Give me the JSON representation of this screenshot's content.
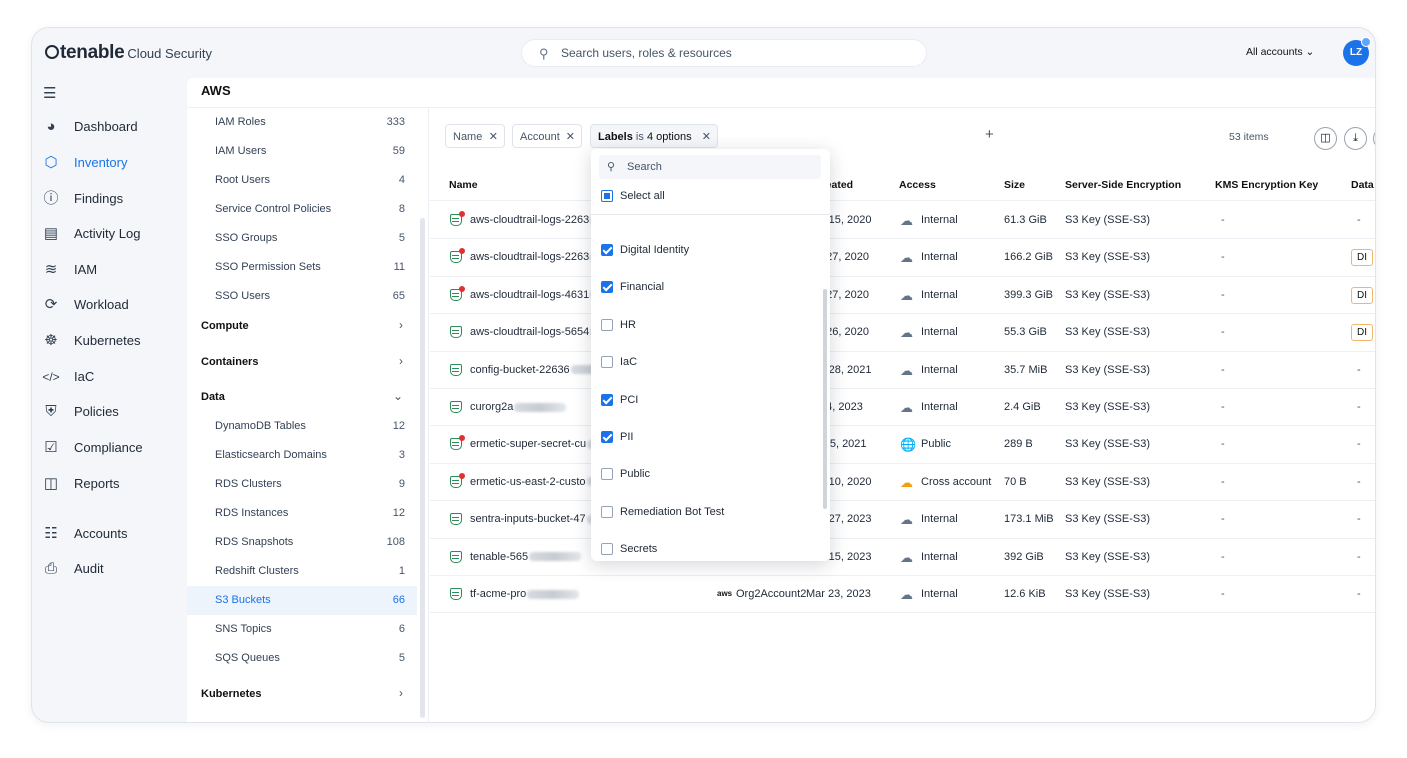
{
  "header": {
    "logo_main": "tenable",
    "logo_sub": "Cloud Security",
    "search_placeholder": "Search users, roles & resources",
    "accounts": "All accounts",
    "avatar": "LZ"
  },
  "nav": {
    "items": [
      {
        "label": "Dashboard",
        "icon": "pie-chart-icon"
      },
      {
        "label": "Inventory",
        "icon": "cube-icon",
        "active": true
      },
      {
        "label": "Findings",
        "icon": "alert-circle-icon"
      },
      {
        "label": "Activity Log",
        "icon": "document-log-icon"
      },
      {
        "label": "IAM",
        "icon": "fingerprint-icon"
      },
      {
        "label": "Workload",
        "icon": "workload-icon"
      },
      {
        "label": "Kubernetes",
        "icon": "kubernetes-helm-icon"
      },
      {
        "label": "IaC",
        "icon": "code-icon"
      },
      {
        "label": "Policies",
        "icon": "shield-check-icon"
      },
      {
        "label": "Compliance",
        "icon": "checkbox-icon"
      },
      {
        "label": "Reports",
        "icon": "report-chart-icon"
      },
      {
        "label": "Accounts",
        "icon": "org-tree-icon"
      },
      {
        "label": "Audit",
        "icon": "audit-search-icon"
      }
    ]
  },
  "panel": {
    "title": "AWS"
  },
  "tree": {
    "iam_items": [
      {
        "label": "IAM Roles",
        "count": "333"
      },
      {
        "label": "IAM Users",
        "count": "59"
      },
      {
        "label": "Root Users",
        "count": "4"
      },
      {
        "label": "Service Control Policies",
        "count": "8"
      },
      {
        "label": "SSO Groups",
        "count": "5"
      },
      {
        "label": "SSO Permission Sets",
        "count": "11"
      },
      {
        "label": "SSO Users",
        "count": "65"
      }
    ],
    "groups": {
      "compute": "Compute",
      "containers": "Containers",
      "data": "Data",
      "kubernetes": "Kubernetes"
    },
    "data_items": [
      {
        "label": "DynamoDB Tables",
        "count": "12"
      },
      {
        "label": "Elasticsearch Domains",
        "count": "3"
      },
      {
        "label": "RDS Clusters",
        "count": "9"
      },
      {
        "label": "RDS Instances",
        "count": "12"
      },
      {
        "label": "RDS Snapshots",
        "count": "108"
      },
      {
        "label": "Redshift Clusters",
        "count": "1"
      },
      {
        "label": "S3 Buckets",
        "count": "66",
        "selected": true
      },
      {
        "label": "SNS Topics",
        "count": "6"
      },
      {
        "label": "SQS Queues",
        "count": "5"
      }
    ]
  },
  "filters": {
    "name": "Name",
    "account": "Account",
    "labels_key": "Labels",
    "labels_op": "is",
    "labels_val": "4 options",
    "items_count": "53 items"
  },
  "table": {
    "headers": {
      "name": "Name",
      "created": "Created",
      "access": "Access",
      "size": "Size",
      "sse": "Server-Side Encryption",
      "kms": "KMS Encryption Key",
      "data": "Data"
    },
    "rows": [
      {
        "name": "aws-cloudtrail-logs-2263",
        "created": "Nov 15, 2020",
        "access": "Internal",
        "size": "61.3 GiB",
        "sse": "S3 Key (SSE-S3)",
        "kms": "-",
        "data": "-",
        "alert": true
      },
      {
        "name": "aws-cloudtrail-logs-2263",
        "created": "Oct 27, 2020",
        "access": "Internal",
        "size": "166.2 GiB",
        "sse": "S3 Key (SSE-S3)",
        "kms": "-",
        "data": "DI",
        "alert": true
      },
      {
        "name": "aws-cloudtrail-logs-4631",
        "created": "Oct 27, 2020",
        "access": "Internal",
        "size": "399.3 GiB",
        "sse": "S3 Key (SSE-S3)",
        "kms": "-",
        "data": "DI",
        "alert": true
      },
      {
        "name": "aws-cloudtrail-logs-5654",
        "created": "Oct 26, 2020",
        "access": "Internal",
        "size": "55.3 GiB",
        "sse": "S3 Key (SSE-S3)",
        "kms": "-",
        "data": "DI",
        "alert": false
      },
      {
        "name": "config-bucket-22636",
        "created": "Aug 28, 2021",
        "access": "Internal",
        "size": "35.7 MiB",
        "sse": "S3 Key (SSE-S3)",
        "kms": "-",
        "data": "-",
        "alert": false
      },
      {
        "name": "curorg2a",
        "created": "Apr 4, 2023",
        "access": "Internal",
        "size": "2.4 GiB",
        "sse": "S3 Key (SSE-S3)",
        "kms": "-",
        "data": "-",
        "alert": false
      },
      {
        "name": "ermetic-super-secret-cu",
        "created": "May 5, 2021",
        "access": "Public",
        "size": "289 B",
        "sse": "S3 Key (SSE-S3)",
        "kms": "-",
        "data": "-",
        "alert": true
      },
      {
        "name": "ermetic-us-east-2-custo",
        "created": "Nov 10, 2020",
        "access": "Cross account",
        "size": "70 B",
        "sse": "S3 Key (SSE-S3)",
        "kms": "-",
        "data": "-",
        "alert": true
      },
      {
        "name": "sentra-inputs-bucket-47",
        "created": "Sep 27, 2023",
        "access": "Internal",
        "size": "173.1 MiB",
        "sse": "S3 Key (SSE-S3)",
        "kms": "-",
        "data": "-",
        "alert": false
      },
      {
        "name": "tenable-565",
        "created": "Nov 15, 2023",
        "access": "Internal",
        "size": "392 GiB",
        "sse": "S3 Key (SSE-S3)",
        "kms": "-",
        "data": "-",
        "alert": false
      },
      {
        "name": "tf-acme-pro",
        "account_logo": "aws",
        "account": "Org2Account2",
        "created": "Mar 23, 2023",
        "access": "Internal",
        "size": "12.6 KiB",
        "sse": "S3 Key (SSE-S3)",
        "kms": "-",
        "data": "-",
        "alert": false
      }
    ]
  },
  "dropdown": {
    "search_placeholder": "Search",
    "select_all": "Select all",
    "options": [
      {
        "label": "Digital Identity",
        "checked": true
      },
      {
        "label": "Financial",
        "checked": true
      },
      {
        "label": "HR",
        "checked": false
      },
      {
        "label": "IaC",
        "checked": false
      },
      {
        "label": "PCI",
        "checked": true
      },
      {
        "label": "PII",
        "checked": true
      },
      {
        "label": "Public",
        "checked": false
      },
      {
        "label": "Remediation Bot Test",
        "checked": false
      },
      {
        "label": "Secrets",
        "checked": false
      }
    ]
  }
}
